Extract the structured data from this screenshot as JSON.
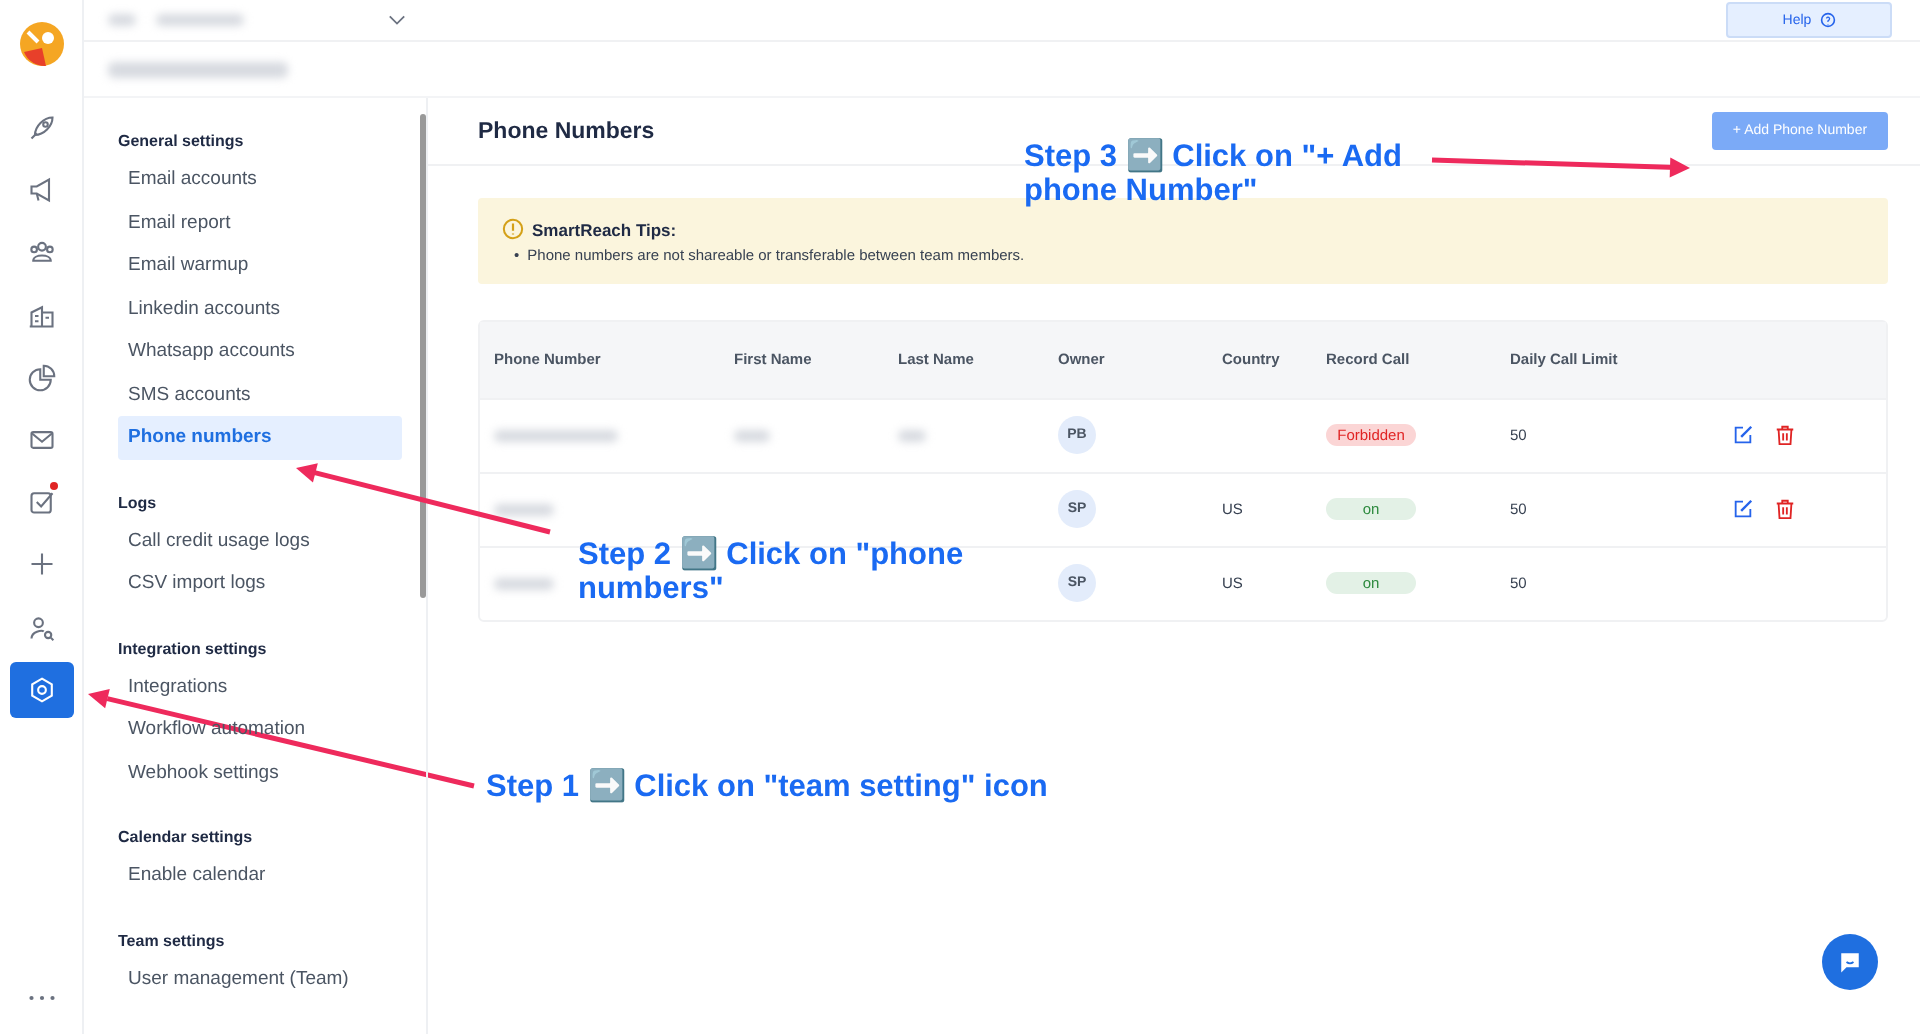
{
  "nav_rail": [
    {
      "kind": "rocket",
      "selected": false,
      "badge": false
    },
    {
      "kind": "megaphone",
      "selected": false,
      "badge": false
    },
    {
      "kind": "people",
      "selected": false,
      "badge": false
    },
    {
      "kind": "building",
      "selected": false,
      "badge": false
    },
    {
      "kind": "pie",
      "selected": false,
      "badge": false
    },
    {
      "kind": "mail",
      "selected": false,
      "badge": false
    },
    {
      "kind": "task",
      "selected": false,
      "badge": true
    },
    {
      "kind": "plus",
      "selected": false,
      "badge": false
    },
    {
      "kind": "user-search",
      "selected": false,
      "badge": false
    },
    {
      "kind": "settings",
      "selected": true,
      "badge": false
    }
  ],
  "top_bar": {
    "help_button": "Help"
  },
  "settings_menu": [
    {
      "heading": "General settings",
      "items": [
        {
          "label": "Email accounts",
          "selected": false
        },
        {
          "label": "Email report",
          "selected": false
        },
        {
          "label": "Email warmup",
          "selected": false
        },
        {
          "label": "Linkedin accounts",
          "selected": false
        },
        {
          "label": "Whatsapp accounts",
          "selected": false
        },
        {
          "label": "SMS accounts",
          "selected": false
        },
        {
          "label": "Phone numbers",
          "selected": true
        }
      ]
    },
    {
      "heading": "Logs",
      "items": [
        {
          "label": "Call credit usage logs",
          "selected": false
        },
        {
          "label": "CSV import logs",
          "selected": false
        }
      ]
    },
    {
      "heading": "Integration settings",
      "items": [
        {
          "label": "Integrations",
          "selected": false
        },
        {
          "label": "Workflow automation",
          "selected": false
        },
        {
          "label": "Webhook settings",
          "selected": false
        }
      ]
    },
    {
      "heading": "Calendar settings",
      "items": [
        {
          "label": "Enable calendar",
          "selected": false
        }
      ]
    },
    {
      "heading": "Team settings",
      "items": [
        {
          "label": "User management (Team)",
          "selected": false
        }
      ]
    }
  ],
  "page": {
    "title": "Phone Numbers",
    "add_button": "+ Add Phone Number"
  },
  "tips": {
    "title": "SmartReach Tips:",
    "marker": "•",
    "bullets": [
      "Phone numbers are not shareable or transferable between team members."
    ]
  },
  "table": {
    "columns": [
      "Phone Number",
      "First Name",
      "Last Name",
      "Owner",
      "Country",
      "Record Call",
      "Daily Call Limit"
    ],
    "rows": [
      {
        "owner": "PB",
        "country": "",
        "record_call": {
          "label": "Forbidden",
          "kind": "forbidden"
        },
        "daily_limit": "50",
        "actions": true
      },
      {
        "owner": "SP",
        "country": "US",
        "record_call": {
          "label": "on",
          "kind": "on"
        },
        "daily_limit": "50",
        "actions": true
      },
      {
        "owner": "SP",
        "country": "US",
        "record_call": {
          "label": "on",
          "kind": "on"
        },
        "daily_limit": "50",
        "actions": false
      }
    ]
  },
  "annotations": [
    "Step 3 ➡️ Click on \"+ Add phone Number\"",
    "Step 2 ➡️ Click on \"phone numbers\"",
    "Step 1 ➡️ Click on \"team setting\" icon"
  ]
}
